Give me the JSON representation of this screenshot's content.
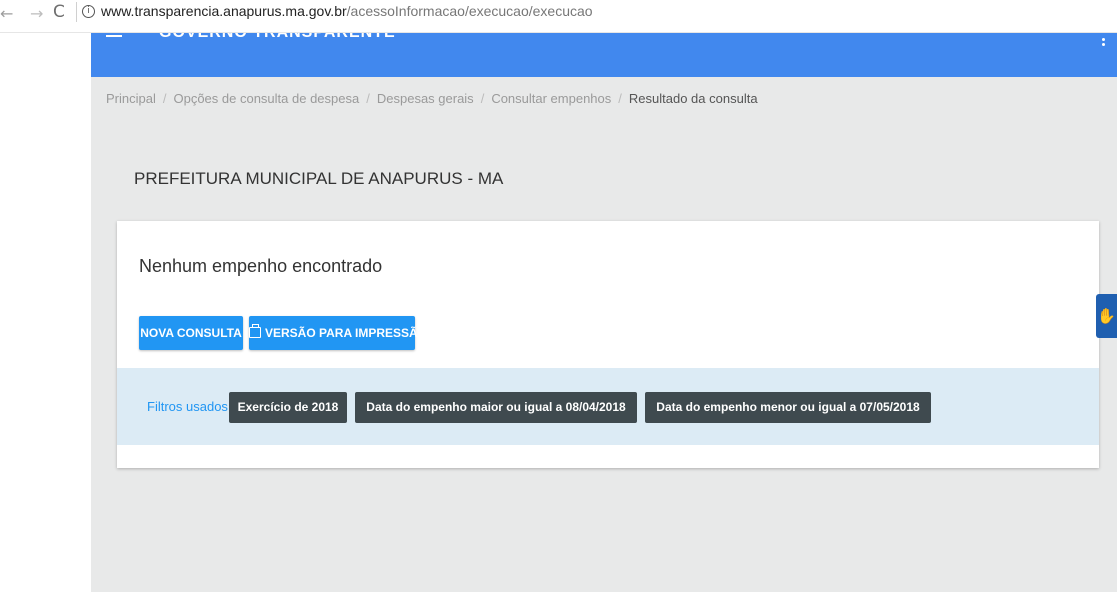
{
  "browser": {
    "back_glyph": "←",
    "forward_glyph": "→",
    "reload_glyph": "C",
    "info_glyph": "i",
    "url_host": "www.transparencia.anapurus.ma.gov.br",
    "url_path": "/acessoInformacao/execucao/execucao"
  },
  "header": {
    "title": "GOVERNO TRANSPARENTE",
    "bg_color": "#4188ee"
  },
  "breadcrumb": {
    "items": [
      "Principal",
      "Opções de consulta de despesa",
      "Despesas gerais",
      "Consultar empenhos",
      "Resultado da consulta"
    ],
    "separator": "/"
  },
  "org_title": "PREFEITURA MUNICIPAL DE ANAPURUS - MA",
  "result": {
    "message": "Nenhum empenho encontrado",
    "new_query_label": "NOVA CONSULTA",
    "print_label": "VERSÃO PARA IMPRESSÃO"
  },
  "filters": {
    "label": "Filtros usados:",
    "tags": [
      "Exercício de 2018",
      "Data do empenho maior ou igual a 08/04/2018",
      "Data do empenho menor ou igual a 07/05/2018"
    ]
  },
  "accessibility": {
    "glyph": "✋",
    "icon": "sign-language-icon"
  },
  "colors": {
    "accent": "#2196f3",
    "filter_tag_bg": "#3f4a4f",
    "filter_bar_bg": "#dcebf5",
    "page_bg": "#e8e9e9"
  }
}
